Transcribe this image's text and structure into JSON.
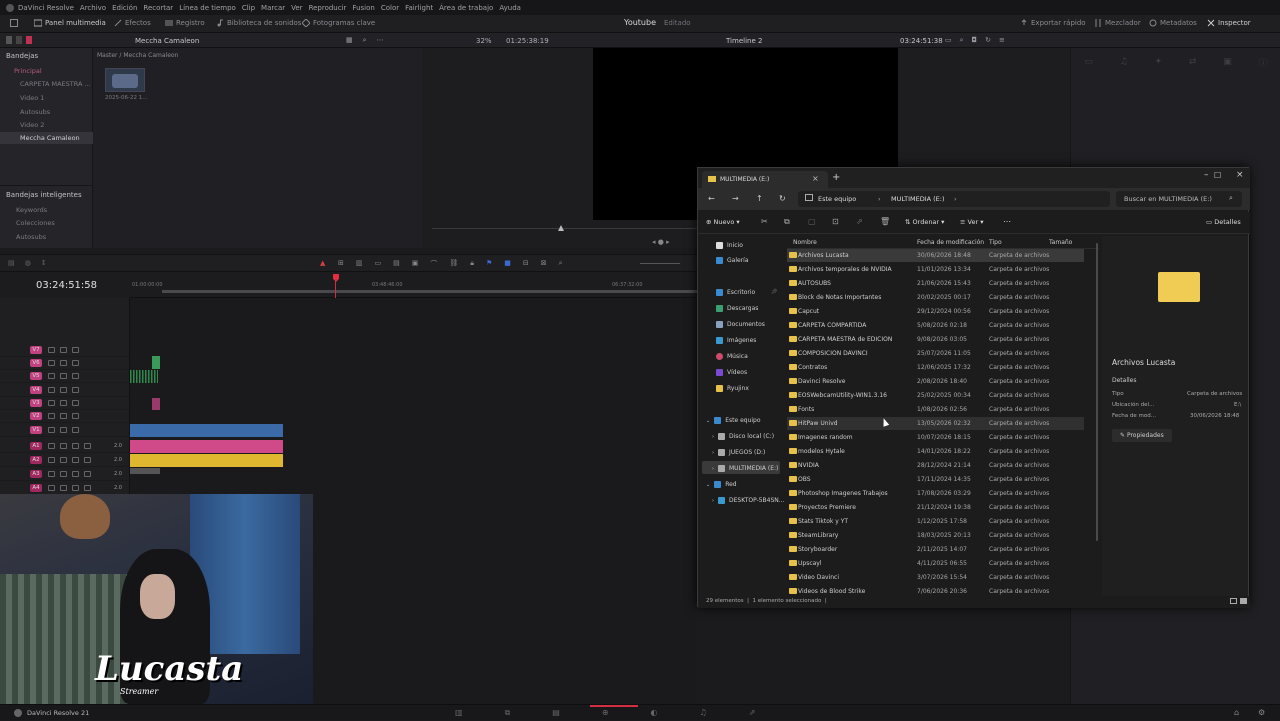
{
  "menu": [
    "DaVinci Resolve",
    "Archivo",
    "Edición",
    "Recortar",
    "Línea de tiempo",
    "Clip",
    "Marcar",
    "Ver",
    "Reproducir",
    "Fusion",
    "Color",
    "Fairlight",
    "Área de trabajo",
    "Ayuda"
  ],
  "toolbar": {
    "media_pool": "Panel multimedia",
    "effects": "Efectos",
    "index": "Registro",
    "sound_library": "Biblioteca de sonidos",
    "keyframes": "Fotogramas clave",
    "project_title": "Youtube",
    "project_status": "Editado",
    "quick_export": "Exportar rápido",
    "mixer": "Mezclador",
    "metadata": "Metadatos",
    "inspector": "Inspector"
  },
  "secondbar": {
    "bins_label": "Bandejas",
    "bin_name": "Meccha Camaleon",
    "zoom": "32%",
    "source_tc": "01:25:38:19",
    "timeline_name": "Timeline 2",
    "record_tc": "03:24:51:38"
  },
  "sidebar": {
    "items": [
      "Principal",
      "CARPETA MAESTRA ...",
      "Video 1",
      "Autosubs",
      "Video 2",
      "Meccha Camaleon"
    ],
    "smart_header": "Bandejas inteligentes",
    "smart_items": [
      "Keywords",
      "Colecciones",
      "Autosubs"
    ]
  },
  "media": {
    "path": "Master / Meccha Camaleon",
    "clip_date": "2025-06-22 1..."
  },
  "timeline": {
    "timecode": "03:24:51:58",
    "ruler": [
      "01:00:00:00",
      "03:48:46:00",
      "06:37:32:00"
    ],
    "video_tracks": [
      "V7",
      "V6",
      "V5",
      "V4",
      "V3",
      "V2",
      "V1"
    ],
    "audio_tracks": [
      "A1",
      "A2",
      "A3",
      "A4"
    ],
    "audio_levels": [
      "2.0",
      "2.0",
      "2.0",
      "2.0"
    ],
    "track_colors": {
      "video": "#d04a8a",
      "audio": "#b03070"
    }
  },
  "explorer": {
    "tab_title": "MULTIMEDIA (E:)",
    "breadcrumb": [
      "Este equipo",
      "MULTIMEDIA (E:)"
    ],
    "search_placeholder": "Buscar en MULTIMEDIA (E:)",
    "cmd_new": "Nuevo",
    "cmd_sort": "Ordenar",
    "cmd_view": "Ver",
    "cmd_details": "Detalles",
    "columns": [
      "Nombre",
      "Fecha de modificación",
      "Tipo",
      "Tamaño"
    ],
    "nav": {
      "home": "Inicio",
      "gallery": "Galería",
      "pinned": [
        "Escritorio",
        "Descargas",
        "Documentos",
        "Imágenes",
        "Música",
        "Vídeos",
        "Ryujinx"
      ],
      "this_pc": "Este equipo",
      "drives": [
        "Disco local (C:)",
        "JUEGOS (D:)",
        "MULTIMEDIA (E:)"
      ],
      "network": "Red",
      "network_items": [
        "DESKTOP-5B4SN..."
      ]
    },
    "files": [
      {
        "name": "Archivos Lucasta",
        "date": "30/06/2026 18:48",
        "type": "Carpeta de archivos"
      },
      {
        "name": "Archivos temporales de NVIDIA",
        "date": "11/01/2026 13:34",
        "type": "Carpeta de archivos"
      },
      {
        "name": "AUTOSUBS",
        "date": "21/06/2026 15:43",
        "type": "Carpeta de archivos"
      },
      {
        "name": "Block de Notas Importantes",
        "date": "20/02/2025 00:17",
        "type": "Carpeta de archivos"
      },
      {
        "name": "Capcut",
        "date": "29/12/2024 00:56",
        "type": "Carpeta de archivos"
      },
      {
        "name": "CARPETA COMPARTIDA",
        "date": "5/08/2026 02:18",
        "type": "Carpeta de archivos"
      },
      {
        "name": "CARPETA MAESTRA de EDICION",
        "date": "9/08/2026 03:05",
        "type": "Carpeta de archivos"
      },
      {
        "name": "COMPOSICION DAVINCI",
        "date": "25/07/2026 11:05",
        "type": "Carpeta de archivos"
      },
      {
        "name": "Contratos",
        "date": "12/06/2025 17:32",
        "type": "Carpeta de archivos"
      },
      {
        "name": "Davinci Resolve",
        "date": "2/08/2026 18:40",
        "type": "Carpeta de archivos"
      },
      {
        "name": "EOSWebcamUtility-WIN1.3.16",
        "date": "25/02/2025 00:34",
        "type": "Carpeta de archivos"
      },
      {
        "name": "Fonts",
        "date": "1/08/2026 02:56",
        "type": "Carpeta de archivos"
      },
      {
        "name": "HitPaw Univd",
        "date": "13/05/2026 02:32",
        "type": "Carpeta de archivos"
      },
      {
        "name": "Imagenes random",
        "date": "10/07/2026 18:15",
        "type": "Carpeta de archivos"
      },
      {
        "name": "modelos Hytale",
        "date": "14/01/2026 18:22",
        "type": "Carpeta de archivos"
      },
      {
        "name": "NVIDIA",
        "date": "28/12/2024 21:14",
        "type": "Carpeta de archivos"
      },
      {
        "name": "OBS",
        "date": "17/11/2024 14:35",
        "type": "Carpeta de archivos"
      },
      {
        "name": "Photoshop Imagenes Trabajos",
        "date": "17/08/2026 03:29",
        "type": "Carpeta de archivos"
      },
      {
        "name": "Proyectos Premiere",
        "date": "21/12/2024 19:38",
        "type": "Carpeta de archivos"
      },
      {
        "name": "Stats Tiktok y YT",
        "date": "1/12/2025 17:58",
        "type": "Carpeta de archivos"
      },
      {
        "name": "SteamLibrary",
        "date": "18/03/2025 20:13",
        "type": "Carpeta de archivos"
      },
      {
        "name": "Storyboarder",
        "date": "2/11/2025 14:07",
        "type": "Carpeta de archivos"
      },
      {
        "name": "Upscayl",
        "date": "4/11/2025 06:55",
        "type": "Carpeta de archivos"
      },
      {
        "name": "Video Davinci",
        "date": "3/07/2026 15:54",
        "type": "Carpeta de archivos"
      },
      {
        "name": "Videos de Blood Strike",
        "date": "7/06/2026 20:36",
        "type": "Carpeta de archivos"
      }
    ],
    "details": {
      "title": "Archivos Lucasta",
      "section": "Detalles",
      "rows": [
        {
          "k": "Tipo",
          "v": "Carpeta de archivos"
        },
        {
          "k": "Ubicación del...",
          "v": "E:\\"
        },
        {
          "k": "Fecha de mod...",
          "v": "30/06/2026 18:48"
        }
      ],
      "properties": "Propiedades"
    },
    "status": "29 elementos  |  1 elemento seleccionado  |"
  },
  "overlay": {
    "streamer": "Lucasta",
    "tagline": "Streamer"
  },
  "footer": {
    "app": "DaVinci Resolve 21"
  }
}
